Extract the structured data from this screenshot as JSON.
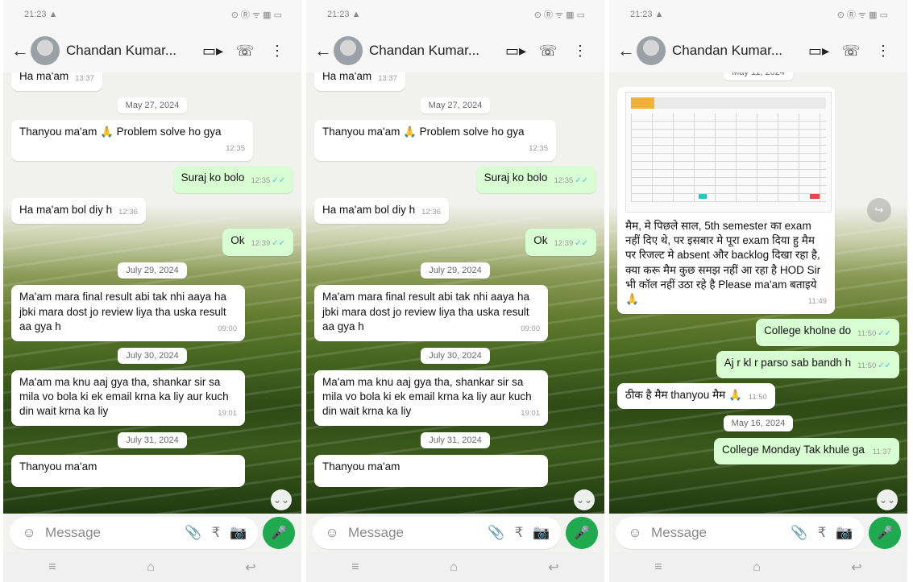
{
  "panels": [
    {
      "status": {
        "time": "21:23 ▲",
        "right": "⊙ Ⓡ ᯤ ▦ ▭"
      },
      "contact": "Chandan Kumar...",
      "messages": [
        {
          "kind": "in",
          "text": "Ha ma'am",
          "time": "13:37",
          "partial": true
        },
        {
          "kind": "date",
          "text": "May 27, 2024"
        },
        {
          "kind": "in",
          "text": "Thanyou ma'am 🙏 Problem solve ho gya",
          "time": "12:35"
        },
        {
          "kind": "out",
          "text": "Suraj ko bolo",
          "time": "12:35"
        },
        {
          "kind": "in",
          "text": "Ha ma'am bol diy h",
          "time": "12:36"
        },
        {
          "kind": "out",
          "text": "Ok",
          "time": "12:39"
        },
        {
          "kind": "date",
          "text": "July 29, 2024"
        },
        {
          "kind": "in",
          "text": "Ma'am mara final result abi tak nhi aaya ha jbki mara dost jo review liya tha uska result aa gya h",
          "time": "09:00"
        },
        {
          "kind": "date",
          "text": "July 30, 2024"
        },
        {
          "kind": "in",
          "text": "Ma'am ma knu aaj gya tha, shankar sir sa mila vo bola ki ek email krna ka liy aur kuch din wait krna ka liy",
          "time": "19:01"
        },
        {
          "kind": "date",
          "text": "July 31, 2024"
        },
        {
          "kind": "in",
          "text": "Thanyou ma'am",
          "time": "",
          "partial": true
        }
      ]
    },
    {
      "status": {
        "time": "21:23 ▲",
        "right": "⊙ Ⓡ ᯤ ▦ ▭"
      },
      "contact": "Chandan Kumar...",
      "messages": [
        {
          "kind": "in",
          "text": "Ha ma'am",
          "time": "13:37",
          "partial": true
        },
        {
          "kind": "date",
          "text": "May 27, 2024"
        },
        {
          "kind": "in",
          "text": "Thanyou ma'am 🙏 Problem solve ho gya",
          "time": "12:35"
        },
        {
          "kind": "out",
          "text": "Suraj ko bolo",
          "time": "12:35"
        },
        {
          "kind": "in",
          "text": "Ha ma'am bol diy h",
          "time": "12:36"
        },
        {
          "kind": "out",
          "text": "Ok",
          "time": "12:39"
        },
        {
          "kind": "date",
          "text": "July 29, 2024"
        },
        {
          "kind": "in",
          "text": "Ma'am mara final result abi tak nhi aaya ha jbki mara dost jo review liya tha uska result aa gya h",
          "time": "09:00"
        },
        {
          "kind": "date",
          "text": "July 30, 2024"
        },
        {
          "kind": "in",
          "text": "Ma'am ma knu aaj gya tha, shankar sir sa mila vo bola ki ek email krna ka liy aur kuch din wait krna ka liy",
          "time": "19:01"
        },
        {
          "kind": "date",
          "text": "July 31, 2024"
        },
        {
          "kind": "in",
          "text": "Thanyou ma'am",
          "time": "",
          "partial": true
        }
      ]
    },
    {
      "status": {
        "time": "21:23 ▲",
        "right": "⊙ Ⓡ ᯤ ▦ ▭"
      },
      "contact": "Chandan Kumar...",
      "messages": [
        {
          "kind": "date",
          "text": "May 11, 2024",
          "partial": true
        },
        {
          "kind": "in-image",
          "text": "मैम, मे पिछले साल, 5th semester का exam नहीं दिए थे, पर इसबार मे पूरा exam दिया हु मैम पर रिजल्ट मे absent और backlog दिखा रहा है, क्या करू मैम कुछ समझ नहीं आ रहा है HOD Sir भी कॉल नहीं उठा रहे है Please ma'am बताइये 🙏",
          "time": "11:49"
        },
        {
          "kind": "out",
          "text": "College kholne do",
          "time": "11:50"
        },
        {
          "kind": "out",
          "text": "Aj r kl r parso sab bandh h",
          "time": "11:50"
        },
        {
          "kind": "in",
          "text": "ठीक है मैम thanyou मैम 🙏",
          "time": "11:50"
        },
        {
          "kind": "date",
          "text": "May 16, 2024"
        },
        {
          "kind": "out",
          "text": "College Monday Tak khule ga",
          "time": "11:37"
        }
      ]
    }
  ],
  "input": {
    "placeholder": "Message"
  },
  "icons": {
    "back": "←",
    "video": "▭▸",
    "call": "☏",
    "menu": "⋮",
    "emoji": "☺",
    "attach": "📎",
    "rupee": "₹",
    "camera": "📷",
    "mic": "🎤",
    "scroll_down": "⌄⌄",
    "forward": "↪",
    "nav_menu": "≡",
    "nav_home": "⌂",
    "nav_back": "↩"
  },
  "colors": {
    "out_bubble": "#d9fdd3",
    "in_bubble": "#ffffff",
    "mic": "#1faa4f",
    "read_ticks": "#53bdeb"
  }
}
